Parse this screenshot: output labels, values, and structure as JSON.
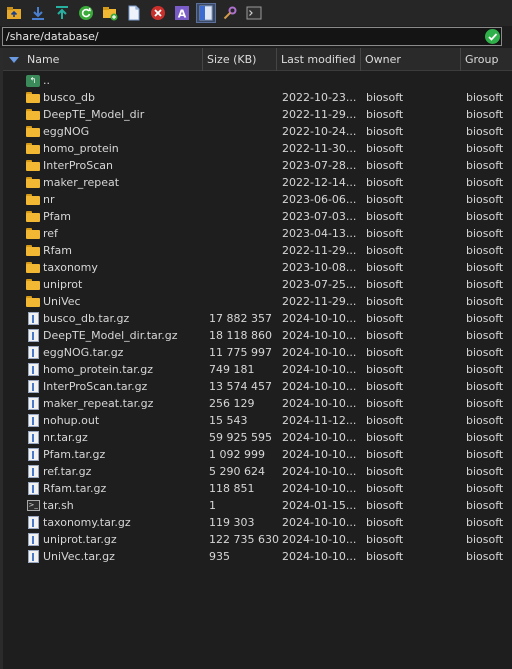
{
  "toolbar": {
    "icons": [
      "parent-folder-icon",
      "download-icon",
      "upload-icon",
      "refresh-icon",
      "new-folder-icon",
      "new-file-icon",
      "delete-icon",
      "rename-icon",
      "split-view-icon",
      "search-icon",
      "terminal-icon"
    ]
  },
  "path": {
    "value": "/share/database/"
  },
  "columns": {
    "name": "Name",
    "size": "Size (KB)",
    "modified": "Last modified",
    "owner": "Owner",
    "group": "Group"
  },
  "rows": [
    {
      "type": "up",
      "name": "..",
      "size": "",
      "modified": "",
      "owner": "",
      "group": ""
    },
    {
      "type": "folder",
      "name": "busco_db",
      "size": "",
      "modified": "2022-10-23...",
      "owner": "biosoft",
      "group": "biosoft"
    },
    {
      "type": "folder",
      "name": "DeepTE_Model_dir",
      "size": "",
      "modified": "2022-11-29...",
      "owner": "biosoft",
      "group": "biosoft"
    },
    {
      "type": "folder",
      "name": "eggNOG",
      "size": "",
      "modified": "2022-10-24...",
      "owner": "biosoft",
      "group": "biosoft"
    },
    {
      "type": "folder",
      "name": "homo_protein",
      "size": "",
      "modified": "2022-11-30...",
      "owner": "biosoft",
      "group": "biosoft"
    },
    {
      "type": "folder",
      "name": "InterProScan",
      "size": "",
      "modified": "2023-07-28...",
      "owner": "biosoft",
      "group": "biosoft"
    },
    {
      "type": "folder",
      "name": "maker_repeat",
      "size": "",
      "modified": "2022-12-14...",
      "owner": "biosoft",
      "group": "biosoft"
    },
    {
      "type": "folder",
      "name": "nr",
      "size": "",
      "modified": "2023-06-06...",
      "owner": "biosoft",
      "group": "biosoft"
    },
    {
      "type": "folder",
      "name": "Pfam",
      "size": "",
      "modified": "2023-07-03...",
      "owner": "biosoft",
      "group": "biosoft"
    },
    {
      "type": "folder",
      "name": "ref",
      "size": "",
      "modified": "2023-04-13...",
      "owner": "biosoft",
      "group": "biosoft"
    },
    {
      "type": "folder",
      "name": "Rfam",
      "size": "",
      "modified": "2022-11-29...",
      "owner": "biosoft",
      "group": "biosoft"
    },
    {
      "type": "folder",
      "name": "taxonomy",
      "size": "",
      "modified": "2023-10-08...",
      "owner": "biosoft",
      "group": "biosoft"
    },
    {
      "type": "folder",
      "name": "uniprot",
      "size": "",
      "modified": "2023-07-25...",
      "owner": "biosoft",
      "group": "biosoft"
    },
    {
      "type": "folder",
      "name": "UniVec",
      "size": "",
      "modified": "2022-11-29...",
      "owner": "biosoft",
      "group": "biosoft"
    },
    {
      "type": "file",
      "name": "busco_db.tar.gz",
      "size": "17 882 357",
      "modified": "2024-10-10...",
      "owner": "biosoft",
      "group": "biosoft"
    },
    {
      "type": "file",
      "name": "DeepTE_Model_dir.tar.gz",
      "size": "18 118 860",
      "modified": "2024-10-10...",
      "owner": "biosoft",
      "group": "biosoft"
    },
    {
      "type": "file",
      "name": "eggNOG.tar.gz",
      "size": "11 775 997",
      "modified": "2024-10-10...",
      "owner": "biosoft",
      "group": "biosoft"
    },
    {
      "type": "file",
      "name": "homo_protein.tar.gz",
      "size": "749 181",
      "modified": "2024-10-10...",
      "owner": "biosoft",
      "group": "biosoft"
    },
    {
      "type": "file",
      "name": "InterProScan.tar.gz",
      "size": "13 574 457",
      "modified": "2024-10-10...",
      "owner": "biosoft",
      "group": "biosoft"
    },
    {
      "type": "file",
      "name": "maker_repeat.tar.gz",
      "size": "256 129",
      "modified": "2024-10-10...",
      "owner": "biosoft",
      "group": "biosoft"
    },
    {
      "type": "file",
      "name": "nohup.out",
      "size": "15 543",
      "modified": "2024-11-12...",
      "owner": "biosoft",
      "group": "biosoft"
    },
    {
      "type": "file",
      "name": "nr.tar.gz",
      "size": "59 925 595",
      "modified": "2024-10-10...",
      "owner": "biosoft",
      "group": "biosoft"
    },
    {
      "type": "file",
      "name": "Pfam.tar.gz",
      "size": "1 092 999",
      "modified": "2024-10-10...",
      "owner": "biosoft",
      "group": "biosoft"
    },
    {
      "type": "file",
      "name": "ref.tar.gz",
      "size": "5 290 624",
      "modified": "2024-10-10...",
      "owner": "biosoft",
      "group": "biosoft"
    },
    {
      "type": "file",
      "name": "Rfam.tar.gz",
      "size": "118 851",
      "modified": "2024-10-10...",
      "owner": "biosoft",
      "group": "biosoft"
    },
    {
      "type": "script",
      "name": "tar.sh",
      "size": "1",
      "modified": "2024-01-15...",
      "owner": "biosoft",
      "group": "biosoft"
    },
    {
      "type": "file",
      "name": "taxonomy.tar.gz",
      "size": "119 303",
      "modified": "2024-10-10...",
      "owner": "biosoft",
      "group": "biosoft"
    },
    {
      "type": "file",
      "name": "uniprot.tar.gz",
      "size": "122 735 630",
      "modified": "2024-10-10...",
      "owner": "biosoft",
      "group": "biosoft"
    },
    {
      "type": "file",
      "name": "UniVec.tar.gz",
      "size": "935",
      "modified": "2024-10-10...",
      "owner": "biosoft",
      "group": "biosoft"
    }
  ]
}
